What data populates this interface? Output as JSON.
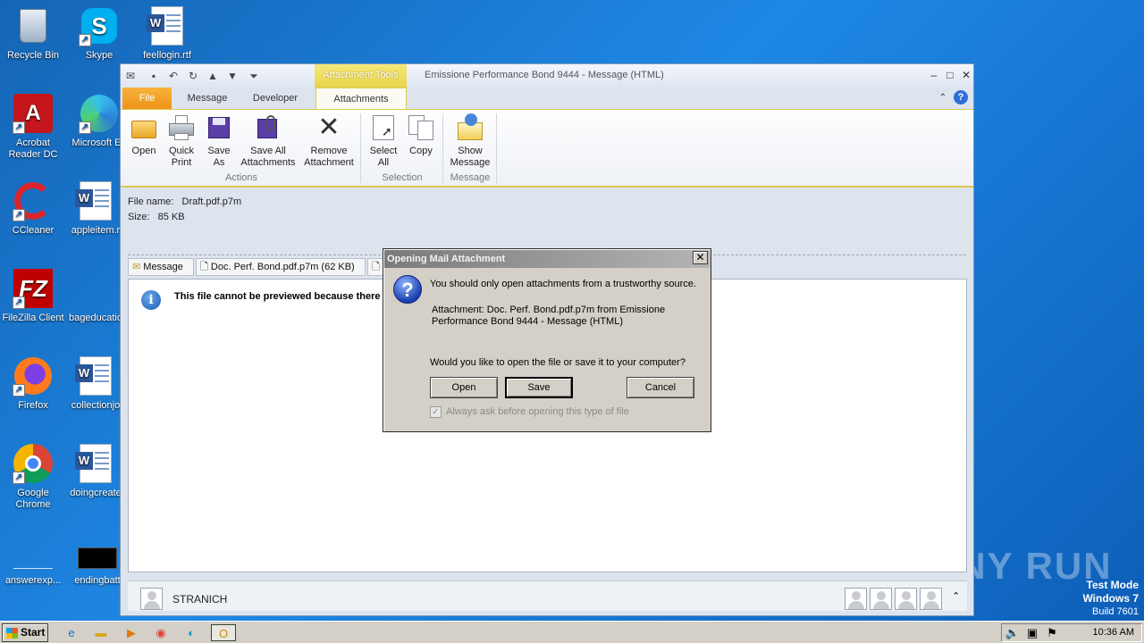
{
  "desktop": {
    "icons": [
      {
        "label": "Recycle Bin"
      },
      {
        "label": "Skype"
      },
      {
        "label": "feellogin.rtf"
      },
      {
        "label": "Acrobat\nReader DC"
      },
      {
        "label": "Microsoft Ed"
      },
      {
        "label": "CCleaner"
      },
      {
        "label": "appleitem.r"
      },
      {
        "label": "FileZilla Client"
      },
      {
        "label": "bageducatio"
      },
      {
        "label": "Firefox"
      },
      {
        "label": "collectionjo"
      },
      {
        "label": "Google\nChrome"
      },
      {
        "label": "doingcreate"
      },
      {
        "label": "answerexp..."
      },
      {
        "label": "endingbatt"
      }
    ]
  },
  "outlook": {
    "contextual_tab": "Attachment Tools",
    "title": "Emissione Performance Bond 9444 -  Message (HTML)",
    "tabs": {
      "file": "File",
      "message": "Message",
      "developer": "Developer",
      "attachments": "Attachments"
    },
    "ribbon": {
      "open": "Open",
      "quick_print": "Quick\nPrint",
      "save_as": "Save\nAs",
      "save_all": "Save All\nAttachments",
      "remove": "Remove\nAttachment",
      "select_all": "Select\nAll",
      "copy": "Copy",
      "show_message": "Show\nMessage",
      "group_actions": "Actions",
      "group_selection": "Selection",
      "group_message": "Message"
    },
    "file_info": {
      "name_label": "File name:",
      "name_value": "Draft.pdf.p7m",
      "size_label": "Size:",
      "size_value": "85 KB"
    },
    "attachment_tabs": {
      "message": "Message",
      "doc": "Doc. Perf. Bond.pdf.p7m (62 KB)"
    },
    "preview_message": "This file cannot be previewed because there is",
    "sender": "STRANICH"
  },
  "dialog": {
    "title": "Opening Mail Attachment",
    "close": "✕",
    "line1": "You should only open attachments from a trustworthy source.",
    "attachment_line1": "Attachment: Doc. Perf. Bond.pdf.p7m from Emissione",
    "attachment_line2": "Performance Bond 9444 - Message (HTML)",
    "question": "Would you like to open the file or save it to your computer?",
    "open_label": "Open",
    "save_label": "Save",
    "cancel_label": "Cancel",
    "checkbox_label": "Always ask before opening this type of file",
    "checkbox_checked": true
  },
  "watermark": "ANY RUN",
  "test_mode": {
    "line1": "Test Mode",
    "line2": "Windows 7",
    "line3": "Build 7601"
  },
  "taskbar": {
    "start_label": "Start",
    "clock": "10:36 AM"
  }
}
